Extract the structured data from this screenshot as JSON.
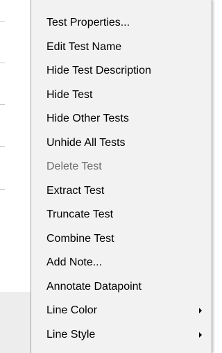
{
  "context_menu": {
    "items": [
      {
        "label": "Test Properties...",
        "enabled": true,
        "has_submenu": false
      },
      {
        "label": "Edit Test Name",
        "enabled": true,
        "has_submenu": false
      },
      {
        "label": "Hide Test Description",
        "enabled": true,
        "has_submenu": false
      },
      {
        "label": "Hide Test",
        "enabled": true,
        "has_submenu": false
      },
      {
        "label": "Hide Other Tests",
        "enabled": true,
        "has_submenu": false
      },
      {
        "label": "Unhide All Tests",
        "enabled": true,
        "has_submenu": false
      },
      {
        "label": "Delete Test",
        "enabled": false,
        "has_submenu": false
      },
      {
        "label": "Extract Test",
        "enabled": true,
        "has_submenu": false
      },
      {
        "label": "Truncate Test",
        "enabled": true,
        "has_submenu": false
      },
      {
        "label": "Combine Test",
        "enabled": true,
        "has_submenu": false
      },
      {
        "label": "Add Note...",
        "enabled": true,
        "has_submenu": false
      },
      {
        "label": "Annotate Datapoint",
        "enabled": true,
        "has_submenu": false
      },
      {
        "label": "Line Color",
        "enabled": true,
        "has_submenu": true
      },
      {
        "label": "Line Style",
        "enabled": true,
        "has_submenu": true
      }
    ]
  },
  "colors": {
    "menu_background": "#f2f2f2",
    "menu_border": "#a0a0a0",
    "text": "#000000",
    "disabled_text": "#6d6d6d"
  },
  "icons": {
    "submenu_arrow": "triangle-right-icon"
  }
}
